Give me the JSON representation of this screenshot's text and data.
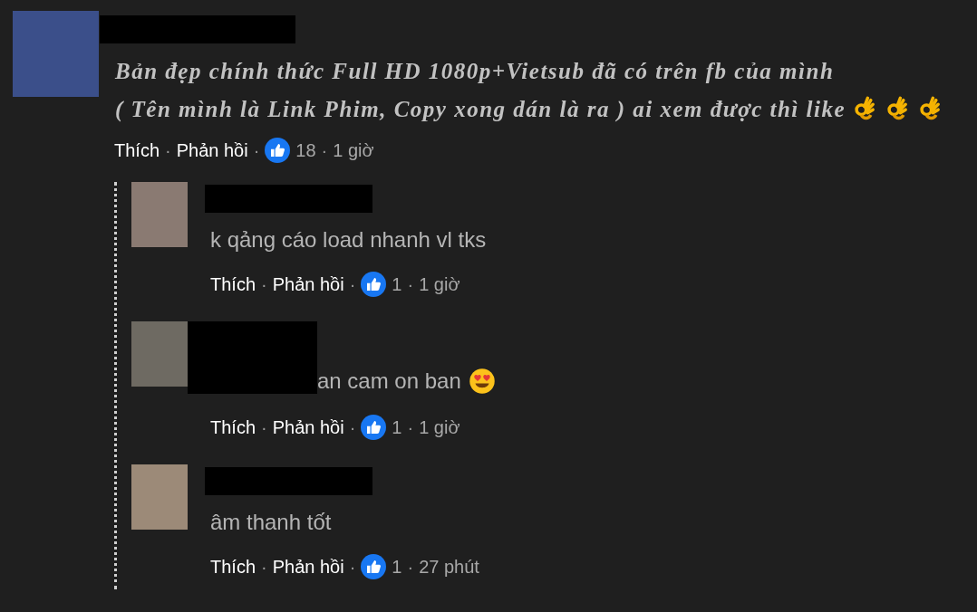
{
  "comment": {
    "text_lines": [
      "Bản đẹp chính thức Full HD 1080p+Vietsub đã có trên fb của mình",
      "( Tên mình là Link Phim, Copy xong dán là ra ) ai xem được thì like"
    ],
    "emojis": [
      {
        "kind": "ok_hand"
      },
      {
        "kind": "ok_hand"
      },
      {
        "kind": "ok_hand"
      }
    ],
    "actions": [
      "Thích",
      "Phản hồi"
    ],
    "separator": "·",
    "reactions": "18",
    "time": "1 giờ"
  },
  "replies": [
    {
      "kind": "plain",
      "text": "k qảng cáo load nhanh vl tks",
      "actions": [
        "Thích",
        "Phản hồi"
      ],
      "separator": "·",
      "reactions": "1",
      "time": "1 giờ"
    },
    {
      "kind": "covered",
      "text": "an cam on ban",
      "emoji": {
        "kind": "heart_eyes"
      },
      "actions": [
        "Thích",
        "Phản hồi"
      ],
      "separator": "·",
      "reactions": "1",
      "time": "1 giờ"
    },
    {
      "kind": "plain",
      "text": "âm thanh tốt",
      "actions": [
        "Thích",
        "Phản hồi"
      ],
      "separator": "·",
      "reactions": "1",
      "time": "27 phút"
    }
  ]
}
